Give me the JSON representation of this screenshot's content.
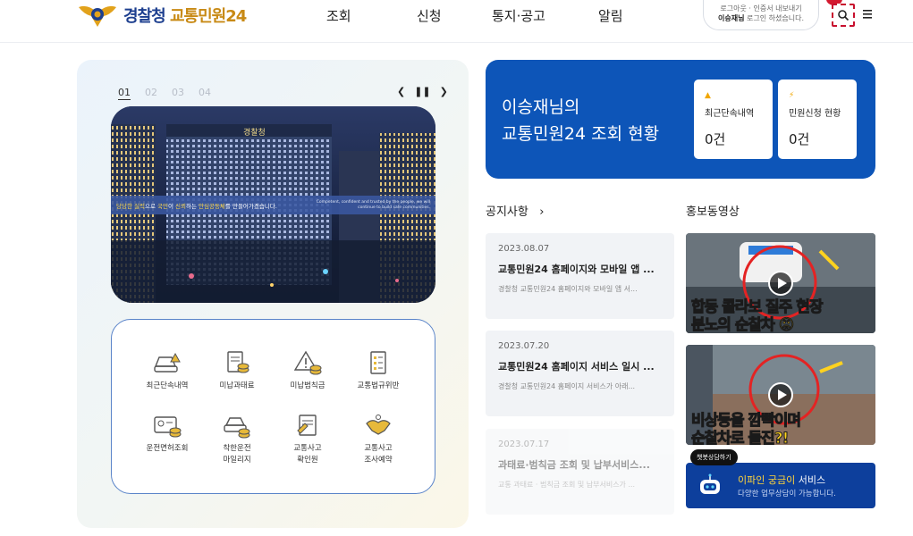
{
  "header": {
    "logo_text_1": "경찰청",
    "logo_text_2": "교통민원24",
    "nav": [
      "조회",
      "신청",
      "통지·공고",
      "알림"
    ],
    "login_links": "로그아웃 · 인증서 내보내기",
    "user_name": "이승재님",
    "login_status": "로그인 하셨습니다."
  },
  "banner": {
    "pages": [
      "01",
      "02",
      "03",
      "04"
    ],
    "building_sign": "경찰청",
    "slogan_part1": "당당한 실력",
    "slogan_part2": "으로 ",
    "slogan_part3": "국민",
    "slogan_part4": "이 ",
    "slogan_part5": "신뢰",
    "slogan_part6": "하는 ",
    "slogan_part7": "안심공동체",
    "slogan_part8": "를 만들어가겠습니다.",
    "slogan_en": "Competent, confident and trusted by the people, we will continue to build safe communities."
  },
  "services": [
    {
      "label": "최근단속내역",
      "icon": "car-warning-icon"
    },
    {
      "label": "미납과태료",
      "icon": "document-coin-icon"
    },
    {
      "label": "미납범칙금",
      "icon": "warning-coin-icon"
    },
    {
      "label": "교통법규위반",
      "icon": "checklist-icon"
    },
    {
      "label": "운전면허조회",
      "icon": "license-card-icon"
    },
    {
      "label": "착한운전",
      "label2": "마일리지",
      "icon": "car-coin-icon"
    },
    {
      "label": "교통사고",
      "label2": "확인원",
      "icon": "certificate-icon"
    },
    {
      "label": "교통사고",
      "label2": "조사예약",
      "icon": "handshake-icon"
    }
  ],
  "status": {
    "title_line1": "이승재님의",
    "title_line2": "교통민원24 조회 현황",
    "cards": [
      {
        "icon": "▲",
        "label": "최근단속내역",
        "value": "0건"
      },
      {
        "icon": "⚡",
        "label": "민원신청 현황",
        "value": "0건"
      }
    ]
  },
  "notices": {
    "title": "공지사항",
    "more": "›",
    "items": [
      {
        "date": "2023.08.07",
        "title": "교통민원24 홈페이지와 모바일 앱 ...",
        "summary": "경찰청 교통민원24 홈페이지와 모바일 앱 서..."
      },
      {
        "date": "2023.07.20",
        "title": "교통민원24 홈페이지 서비스 일시 ...",
        "summary": "경찰청 교통민원24 홈페이지 서비스가 아래..."
      },
      {
        "date": "2023.07.17",
        "title": "과태료·범칙금 조회 및 납부서비스...",
        "summary": "교통 과태료 · 범칙금 조회 및 납부서비스가 ..."
      }
    ]
  },
  "videos": {
    "title": "홍보동영상",
    "items": [
      {
        "caption1": "합동 콜라보 질주 현장",
        "caption2": "분노의 순찰차 😡"
      },
      {
        "caption1": "비상등을 깜빡이며",
        "caption2": "순찰차로 돌진?!"
      }
    ]
  },
  "chatbot": {
    "tag": "챗봇상담하기",
    "title_hl": "이파인 궁금이",
    "title_rest": " 서비스",
    "subtitle": "다양한 업무상담이 가능합니다."
  }
}
